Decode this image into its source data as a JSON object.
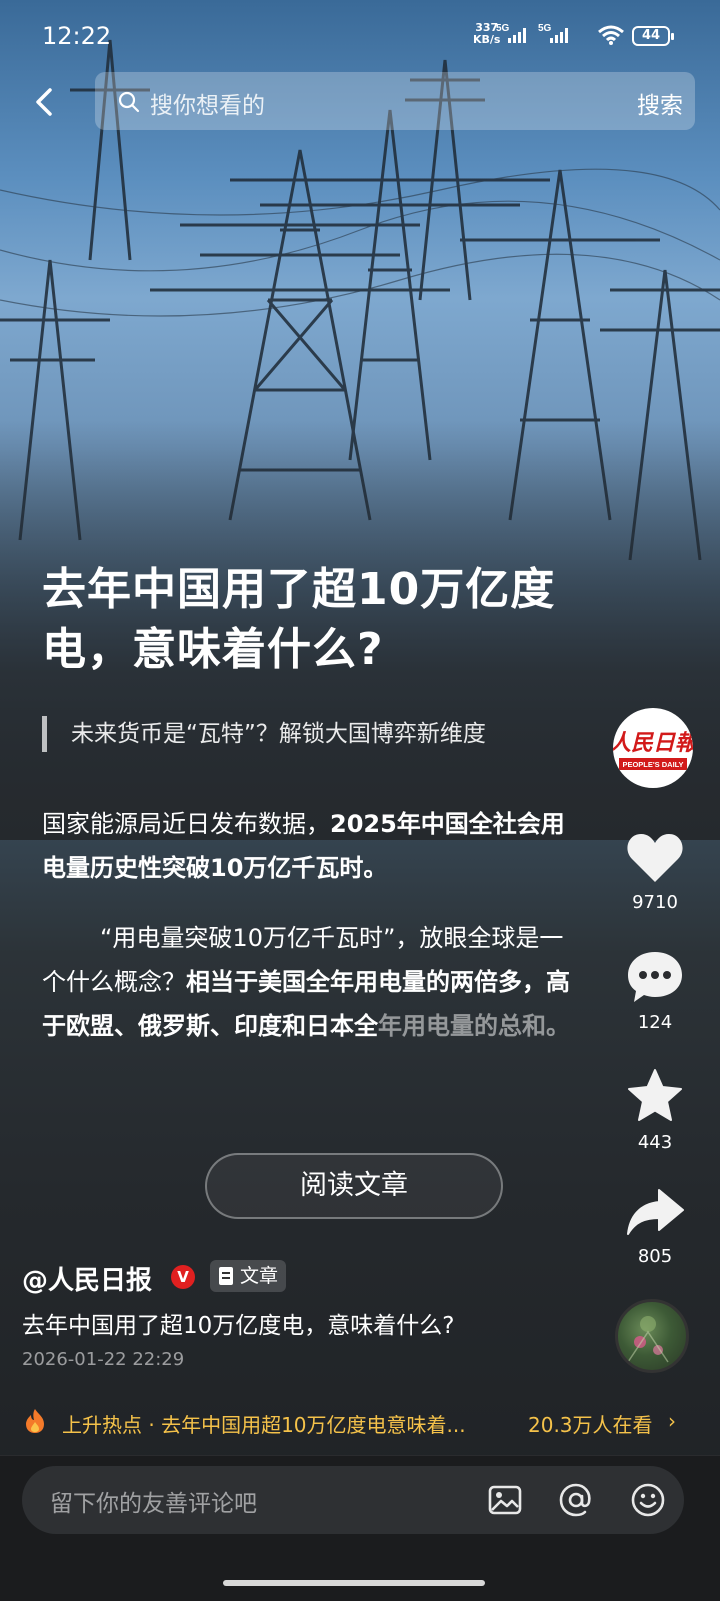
{
  "status_bar": {
    "time": "12:22",
    "net_speed_top": "337",
    "net_speed_unit": "KB/s",
    "sig1": "5G",
    "sig2": "5G",
    "battery": "44"
  },
  "search": {
    "placeholder": "搜你想看的",
    "button": "搜索"
  },
  "article": {
    "title": "去年中国用了超10万亿度电，意味着什么?",
    "subtitle": "未来货币是“瓦特”？解锁大国博弈新维度",
    "p1_normal": "国家能源局近日发布数据，",
    "p1_bold": "2025年中国全社会用电量历史性突破10万亿千瓦时。",
    "p2_normal": "“用电量突破10万亿千瓦时”，放眼全球是一个什么概念？",
    "p2_bold": "相当于美国全年用电量的两倍多，高于欧盟、俄罗斯、印度和日本全",
    "p2_fade": "年用电量的总和。",
    "read_button": "阅读文章"
  },
  "actions": {
    "likes": "9710",
    "comments": "124",
    "favorites": "443",
    "shares": "805"
  },
  "author": {
    "name": "@人民日报",
    "verified": "V",
    "tag": "文章",
    "description": "去年中国用了超10万亿度电，意味着什么?",
    "date": "2026-01-22 22:29",
    "logo_text": "人民日报",
    "logo_en": "PEOPLE'S DAILY"
  },
  "hot": {
    "text": "上升热点 · 去年中国用超10万亿度电意味着...",
    "count": "20.3万人在看",
    "arrow": "›"
  },
  "comment": {
    "placeholder": "留下你的友善评论吧"
  },
  "colors": {
    "accent_hot": "#f5c24a",
    "verified_red": "#e02020",
    "background": "#1f2124"
  }
}
